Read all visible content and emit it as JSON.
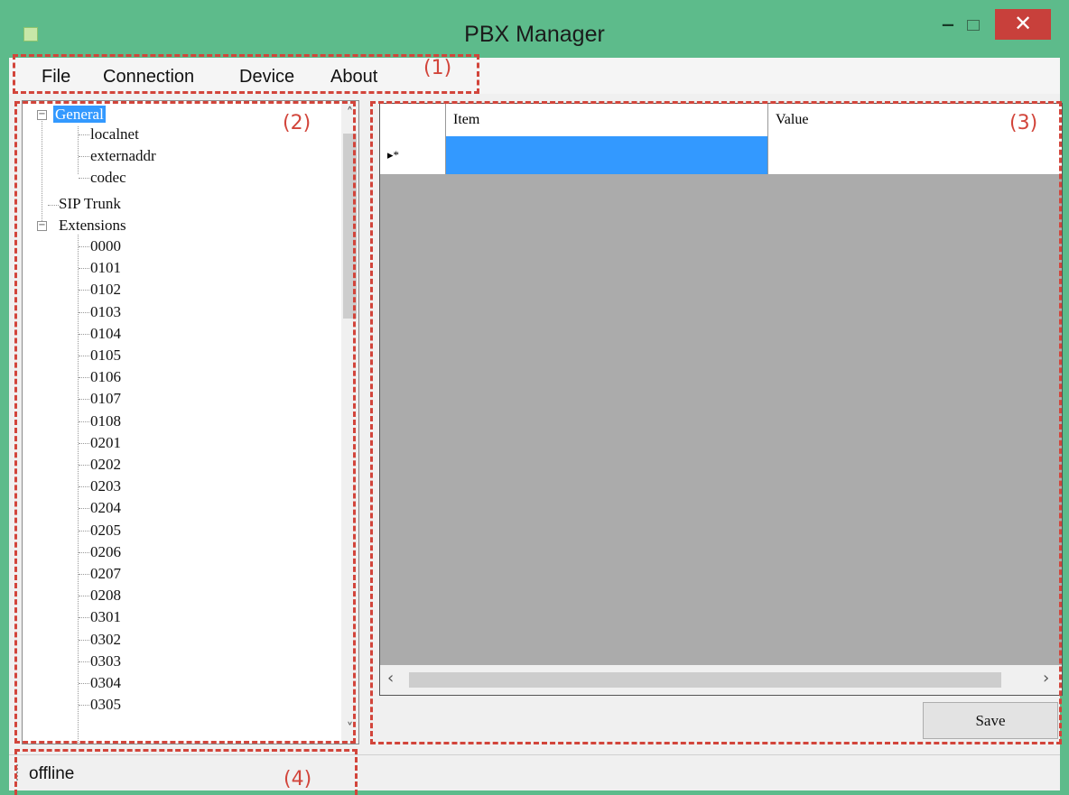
{
  "window": {
    "title": "PBX Manager",
    "minimize_glyph": "‒",
    "close_glyph": "✕",
    "accent": "#5dbb8b",
    "close_color": "#c8403b"
  },
  "menu": {
    "items": [
      {
        "label": "File"
      },
      {
        "label": "Connection"
      },
      {
        "label": "Device"
      },
      {
        "label": "About"
      }
    ]
  },
  "tree": {
    "general": {
      "label": "General",
      "children": [
        "localnet",
        "externaddr",
        "codec"
      ]
    },
    "sip_trunk": {
      "label": "SIP Trunk"
    },
    "extensions": {
      "label": "Extensions",
      "children": [
        "0000",
        "0101",
        "0102",
        "0103",
        "0104",
        "0105",
        "0106",
        "0107",
        "0108",
        "0201",
        "0202",
        "0203",
        "0204",
        "0205",
        "0206",
        "0207",
        "0208",
        "0301",
        "0302",
        "0303",
        "0304",
        "0305"
      ]
    },
    "collapse_glyph": "−"
  },
  "grid": {
    "columns": [
      "Item",
      "Value"
    ],
    "new_row_marker": "▸*",
    "selection_color": "#3399ff"
  },
  "save_label": "Save",
  "status": "offline",
  "annotations": [
    "(1)",
    "(2)",
    "(3)",
    "(4)"
  ],
  "annotation_color": "#d2453b",
  "icons": {
    "app": "app-icon",
    "minimize": "minimize-icon",
    "maximize": "maximize-icon",
    "close": "close-icon",
    "scroll_up": "chevron-up-icon",
    "scroll_down": "chevron-down-icon",
    "scroll_left": "chevron-left-icon",
    "scroll_right": "chevron-right-icon"
  }
}
